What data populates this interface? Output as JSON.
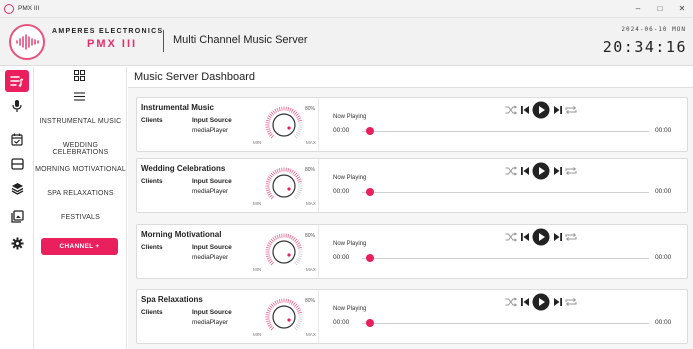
{
  "window": {
    "title": "PMX III",
    "controls": [
      "–",
      "□",
      "✕"
    ]
  },
  "header": {
    "brand_name": "AMPERES ELECTRONICS",
    "brand_product": "PMX III",
    "app_title": "Multi Channel Music Server",
    "date": "2024-06-10 MON",
    "time": "20:34:16"
  },
  "rail": {
    "items": [
      {
        "icon": "playlist-icon",
        "active": true
      },
      {
        "icon": "microphone-icon",
        "active": false
      },
      {
        "icon": "calendar-check-icon",
        "active": false
      },
      {
        "icon": "window-icon",
        "active": false
      },
      {
        "icon": "layers-icon",
        "active": false
      },
      {
        "icon": "gallery-icon",
        "active": false
      },
      {
        "icon": "gear-icon",
        "active": false
      }
    ]
  },
  "sidebar": {
    "grid_icon": "grid-icon",
    "list_icon": "list-icon",
    "items": [
      {
        "label": "INSTRUMENTAL MUSIC"
      },
      {
        "label": "WEDDING CELEBRATIONS"
      },
      {
        "label": "MORNING MOTIVATIONAL"
      },
      {
        "label": "SPA RELAXATIONS"
      },
      {
        "label": "FESTIVALS"
      }
    ],
    "add_button": "CHANNEL  +"
  },
  "main": {
    "title": "Music Server Dashboard",
    "channels": [
      {
        "name": "Instrumental Music",
        "clients_label": "Clients",
        "source_label": "Input Source",
        "source_value": "mediaPlayer",
        "volume": "80%",
        "volume_min": "MIN",
        "volume_max": "MAX",
        "now_playing": "Now Playing",
        "time_start": "00:00",
        "time_end": "00:00"
      },
      {
        "name": "Wedding Celebrations",
        "clients_label": "Clients",
        "source_label": "Input Source",
        "source_value": "mediaPlayer",
        "volume": "80%",
        "volume_min": "MIN",
        "volume_max": "MAX",
        "now_playing": "Now Playing",
        "time_start": "00:00",
        "time_end": "00:00"
      },
      {
        "name": "Morning Motivational",
        "clients_label": "Clients",
        "source_label": "Input Source",
        "source_value": "mediaPlayer",
        "volume": "80%",
        "volume_min": "MIN",
        "volume_max": "MAX",
        "now_playing": "Now Playing",
        "time_start": "00:00",
        "time_end": "00:00"
      },
      {
        "name": "Spa Relaxations",
        "clients_label": "Clients",
        "source_label": "Input Source",
        "source_value": "mediaPlayer",
        "volume": "80%",
        "volume_min": "MIN",
        "volume_max": "MAX",
        "now_playing": "Now Playing",
        "time_start": "00:00",
        "time_end": "00:00"
      }
    ]
  },
  "colors": {
    "accent": "#ea1f5d",
    "header_bg": "#f2f2f2",
    "main_bg": "#f6f6f6"
  }
}
